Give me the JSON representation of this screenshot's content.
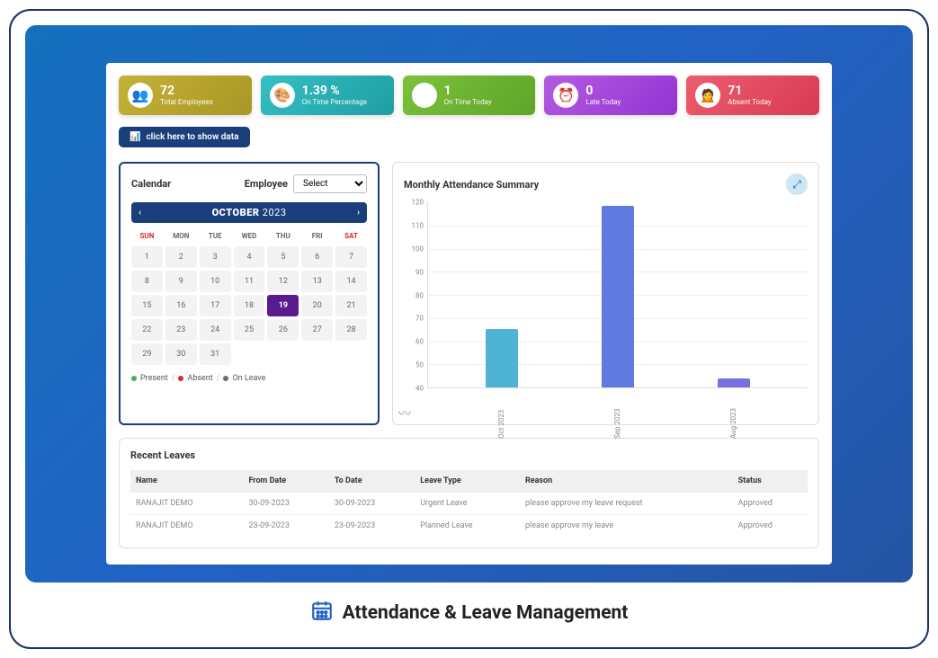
{
  "stats": [
    {
      "value": "72",
      "label": "Total Employees",
      "bg": "linear-gradient(135deg,#c4b239,#a99624)",
      "emoji": "👥"
    },
    {
      "value": "1.39 %",
      "label": "On Time Percentage",
      "bg": "linear-gradient(135deg,#35bfc4,#1f9ea3)",
      "emoji": "🎨"
    },
    {
      "value": "1",
      "label": "On Time Today",
      "bg": "linear-gradient(135deg,#7cc23c,#5ea428)",
      "emoji": "⏱"
    },
    {
      "value": "0",
      "label": "Late Today",
      "bg": "linear-gradient(135deg,#b45be0,#9333d4)",
      "emoji": "⏰"
    },
    {
      "value": "71",
      "label": "Absent Today",
      "bg": "linear-gradient(135deg,#ec5d6f,#d83a52)",
      "emoji": "🙍"
    }
  ],
  "show_button": "click here to show data",
  "calendar": {
    "title": "Calendar",
    "employee_label": "Employee",
    "select_placeholder": "Select",
    "month": "OCTOBER",
    "year": "2023",
    "day_headers": [
      "SUN",
      "MON",
      "TUE",
      "WED",
      "THU",
      "FRI",
      "SAT"
    ],
    "weekend_idx": [
      0,
      6
    ],
    "days": [
      1,
      2,
      3,
      4,
      5,
      6,
      7,
      8,
      9,
      10,
      11,
      12,
      13,
      14,
      15,
      16,
      17,
      18,
      19,
      20,
      21,
      22,
      23,
      24,
      25,
      26,
      27,
      28,
      29,
      30,
      31
    ],
    "current": 19,
    "legend": [
      {
        "c": "#3fb54a",
        "t": "Present"
      },
      {
        "c": "#d82828",
        "t": "Absent"
      },
      {
        "c": "#6b6b6b",
        "t": "On Leave"
      }
    ]
  },
  "chart_title": "Monthly Attendance Summary",
  "chart_data": {
    "type": "bar",
    "categories": [
      "Oct 2023",
      "Sep 2023",
      "Aug 2023"
    ],
    "values": [
      65,
      118,
      44
    ],
    "colors": [
      "#4fb3d4",
      "#5f7be0",
      "#7a6fe0"
    ],
    "ylim": [
      40,
      120
    ],
    "ystep": 10,
    "title": "Monthly Attendance Summary",
    "xlabel": "",
    "ylabel": ""
  },
  "leaves": {
    "title": "Recent Leaves",
    "columns": [
      "Name",
      "From Date",
      "To Date",
      "Leave Type",
      "Reason",
      "Status"
    ],
    "rows": [
      [
        "RANAJIT DEMO",
        "30-09-2023",
        "30-09-2023",
        "Urgent Leave",
        "please approve my leave request",
        "Approved"
      ],
      [
        "RANAJIT DEMO",
        "23-09-2023",
        "23-09-2023",
        "Planned Leave",
        "please approve my leave",
        "Approved"
      ]
    ]
  },
  "footer": "Attendance & Leave Management"
}
